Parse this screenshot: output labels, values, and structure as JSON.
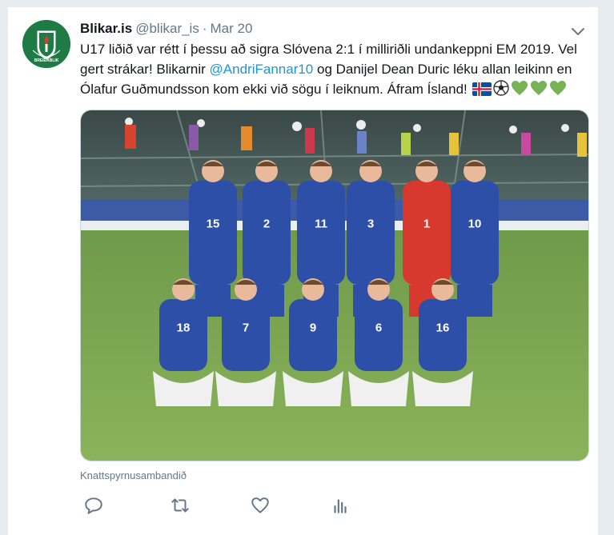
{
  "tweet": {
    "display_name": "Blikar.is",
    "handle": "@blikar_is",
    "separator": "·",
    "date": "Mar 20",
    "text_part1": "U17 liðið var rétt í þessu að sigra Slóvena 2:1 í milliriðli undankeppni EM 2019. Vel gert strákar! Blikarnir ",
    "mention": "@AndriFannar10",
    "text_part2": " og Danijel Dean Duric léku allan leikinn en Ólafur Guðmundsson kom ekki við sögu í leiknum. Áfram Ísland! ",
    "emojis": [
      "iceland-flag",
      "soccer-ball",
      "green-heart",
      "green-heart",
      "green-heart"
    ],
    "photo_credit": "Knattspyrnusambandið",
    "photo_alt_shirt_numbers": [
      "15",
      "2",
      "11",
      "3",
      "1",
      "10",
      "18",
      "7",
      "9",
      "6",
      "16"
    ]
  },
  "avatar": {
    "label": "BREIÐABLIK"
  },
  "actions": {
    "icons": [
      "reply-icon",
      "retweet-icon",
      "like-icon",
      "analytics-icon"
    ]
  },
  "colors": {
    "link": "#1b95e0",
    "muted": "#657786",
    "text": "#14171a",
    "brand_green": "#1e7b46",
    "heart_green": "#77b255"
  }
}
